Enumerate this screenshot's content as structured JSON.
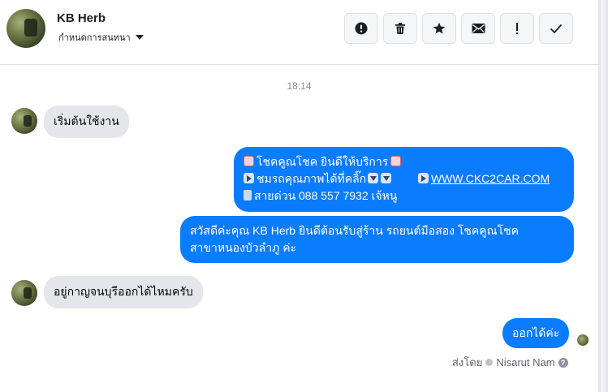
{
  "header": {
    "contact_name": "KB Herb",
    "subtitle": "กำหนดการสนทนา",
    "actions": [
      {
        "icon": "alert-circle-icon",
        "name": "report-button"
      },
      {
        "icon": "trash-icon",
        "name": "delete-button"
      },
      {
        "icon": "star-icon",
        "name": "star-button"
      },
      {
        "icon": "envelope-icon",
        "name": "mark-unread-button"
      },
      {
        "icon": "exclamation-icon",
        "name": "spam-button"
      },
      {
        "icon": "check-icon",
        "name": "done-button"
      }
    ]
  },
  "conversation": {
    "timestamp": "18:14",
    "messages": [
      {
        "direction": "in",
        "text": "เริ่มต้นใช้งาน"
      },
      {
        "direction": "out",
        "lines": {
          "l1": "โชคคูณโชค ยินดีให้บริการ",
          "l2": "ชมรถคุณภาพได้ที่คลิ๊ก",
          "l2_link": "WWW.CKC2CAR.COM",
          "l3": "สายด่วน 088 557 7932 เจ้หนู"
        }
      },
      {
        "direction": "out",
        "lines": {
          "l1": "สวัสดีค่ะคุณ KB Herb ยินดีต้อนรับสู่ร้าน รถยนต์มือสอง โชคคูณโชค",
          "l2": "สาขาหนองบัวลำภู ค่ะ"
        }
      },
      {
        "direction": "in",
        "text": "อยู่กาญจนบุรีออกได้ไหมครับ"
      },
      {
        "direction": "out",
        "text": "ออกได้ค่ะ"
      }
    ],
    "sent_by_label": "ส่งโดย",
    "sent_by_name": "Nisarut Nam",
    "help_glyph": "?"
  },
  "colors": {
    "outgoing_bubble": "#0a7cff",
    "incoming_bubble": "#e4e6eb"
  }
}
